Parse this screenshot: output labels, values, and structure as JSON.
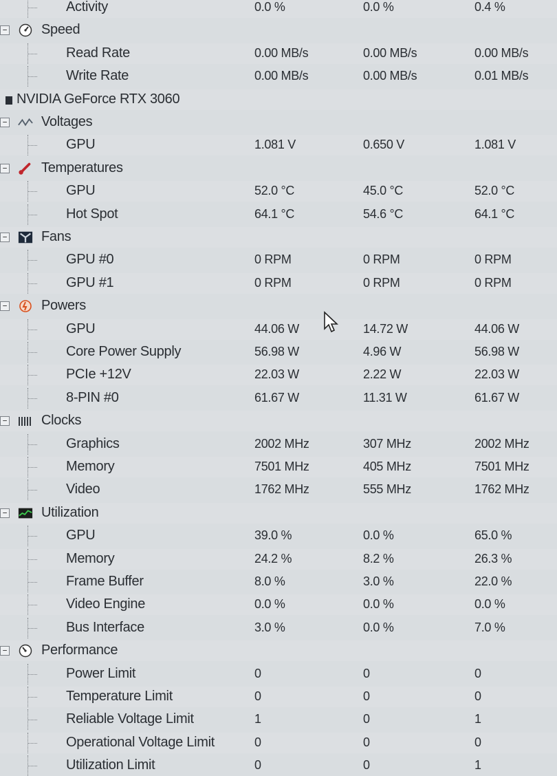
{
  "rows": [
    {
      "id": "activity",
      "label": "Activity",
      "level": 3,
      "values": [
        "0.0 %",
        "0.0 %",
        "0.4 %"
      ]
    },
    {
      "id": "speed",
      "label": "Speed",
      "level": 1,
      "group": true,
      "expander": "minus",
      "icon": "speed-icon",
      "values": [
        "",
        "",
        ""
      ]
    },
    {
      "id": "read-rate",
      "label": "Read Rate",
      "level": 3,
      "values": [
        "0.00 MB/s",
        "0.00 MB/s",
        "0.00 MB/s"
      ]
    },
    {
      "id": "write-rate",
      "label": "Write Rate",
      "level": 3,
      "values": [
        "0.00 MB/s",
        "0.00 MB/s",
        "0.01 MB/s"
      ]
    },
    {
      "id": "gpu-device",
      "label": "NVIDIA GeForce RTX 3060",
      "level": 0,
      "group": true,
      "icon": "gpu-card-icon",
      "values": [
        "",
        "",
        ""
      ]
    },
    {
      "id": "voltages",
      "label": "Voltages",
      "level": 1,
      "group": true,
      "expander": "minus",
      "icon": "voltage-icon",
      "values": [
        "",
        "",
        ""
      ]
    },
    {
      "id": "voltage-gpu",
      "label": "GPU",
      "level": 3,
      "values": [
        "1.081 V",
        "0.650 V",
        "1.081 V"
      ]
    },
    {
      "id": "temperatures",
      "label": "Temperatures",
      "level": 1,
      "group": true,
      "expander": "minus",
      "icon": "thermometer-icon",
      "values": [
        "",
        "",
        ""
      ]
    },
    {
      "id": "temp-gpu",
      "label": "GPU",
      "level": 3,
      "values": [
        "52.0 °C",
        "45.0 °C",
        "52.0 °C"
      ]
    },
    {
      "id": "temp-hotspot",
      "label": "Hot Spot",
      "level": 3,
      "values": [
        "64.1 °C",
        "54.6 °C",
        "64.1 °C"
      ]
    },
    {
      "id": "fans",
      "label": "Fans",
      "level": 1,
      "group": true,
      "expander": "minus",
      "icon": "fan-icon",
      "values": [
        "",
        "",
        ""
      ]
    },
    {
      "id": "fan-gpu0",
      "label": "GPU #0",
      "level": 3,
      "values": [
        "0 RPM",
        "0 RPM",
        "0 RPM"
      ]
    },
    {
      "id": "fan-gpu1",
      "label": "GPU #1",
      "level": 3,
      "values": [
        "0 RPM",
        "0 RPM",
        "0 RPM"
      ]
    },
    {
      "id": "powers",
      "label": "Powers",
      "level": 1,
      "group": true,
      "expander": "minus",
      "icon": "power-icon",
      "values": [
        "",
        "",
        ""
      ]
    },
    {
      "id": "power-gpu",
      "label": "GPU",
      "level": 3,
      "values": [
        "44.06 W",
        "14.72 W",
        "44.06 W"
      ]
    },
    {
      "id": "power-core",
      "label": "Core Power Supply",
      "level": 3,
      "values": [
        "56.98 W",
        "4.96 W",
        "56.98 W"
      ]
    },
    {
      "id": "power-pcie",
      "label": "PCIe +12V",
      "level": 3,
      "values": [
        "22.03 W",
        "2.22 W",
        "22.03 W"
      ]
    },
    {
      "id": "power-8pin",
      "label": "8-PIN #0",
      "level": 3,
      "values": [
        "61.67 W",
        "11.31 W",
        "61.67 W"
      ]
    },
    {
      "id": "clocks",
      "label": "Clocks",
      "level": 1,
      "group": true,
      "expander": "minus",
      "icon": "clock-bars-icon",
      "values": [
        "",
        "",
        ""
      ]
    },
    {
      "id": "clock-graphics",
      "label": "Graphics",
      "level": 3,
      "values": [
        "2002 MHz",
        "307 MHz",
        "2002 MHz"
      ]
    },
    {
      "id": "clock-memory",
      "label": "Memory",
      "level": 3,
      "values": [
        "7501 MHz",
        "405 MHz",
        "7501 MHz"
      ]
    },
    {
      "id": "clock-video",
      "label": "Video",
      "level": 3,
      "values": [
        "1762 MHz",
        "555 MHz",
        "1762 MHz"
      ]
    },
    {
      "id": "utilization",
      "label": "Utilization",
      "level": 1,
      "group": true,
      "expander": "minus",
      "icon": "utilization-icon",
      "values": [
        "",
        "",
        ""
      ]
    },
    {
      "id": "util-gpu",
      "label": "GPU",
      "level": 3,
      "values": [
        "39.0 %",
        "0.0 %",
        "65.0 %"
      ]
    },
    {
      "id": "util-memory",
      "label": "Memory",
      "level": 3,
      "values": [
        "24.2 %",
        "8.2 %",
        "26.3 %"
      ]
    },
    {
      "id": "util-framebuffer",
      "label": "Frame Buffer",
      "level": 3,
      "values": [
        "8.0 %",
        "3.0 %",
        "22.0 %"
      ]
    },
    {
      "id": "util-videoengine",
      "label": "Video Engine",
      "level": 3,
      "values": [
        "0.0 %",
        "0.0 %",
        "0.0 %"
      ]
    },
    {
      "id": "util-bus",
      "label": "Bus Interface",
      "level": 3,
      "values": [
        "3.0 %",
        "0.0 %",
        "7.0 %"
      ]
    },
    {
      "id": "performance",
      "label": "Performance",
      "level": 1,
      "group": true,
      "expander": "minus",
      "icon": "performance-icon",
      "values": [
        "",
        "",
        ""
      ]
    },
    {
      "id": "perf-power",
      "label": "Power Limit",
      "level": 3,
      "values": [
        "0",
        "0",
        "0"
      ]
    },
    {
      "id": "perf-temp",
      "label": "Temperature Limit",
      "level": 3,
      "values": [
        "0",
        "0",
        "0"
      ]
    },
    {
      "id": "perf-reliable",
      "label": "Reliable Voltage Limit",
      "level": 3,
      "values": [
        "1",
        "0",
        "1"
      ]
    },
    {
      "id": "perf-operational",
      "label": "Operational Voltage Limit",
      "level": 3,
      "values": [
        "0",
        "0",
        "0"
      ]
    },
    {
      "id": "perf-utilization",
      "label": "Utilization Limit",
      "level": 3,
      "values": [
        "0",
        "0",
        "1"
      ]
    }
  ],
  "colors": {
    "background": "#d9dde0",
    "text": "#2a2e33",
    "fan_icon": "#1e2a3a",
    "temp_icon": "#c0262c",
    "power_icon": "#d8501e",
    "util_icon": "#1f6b2a"
  }
}
